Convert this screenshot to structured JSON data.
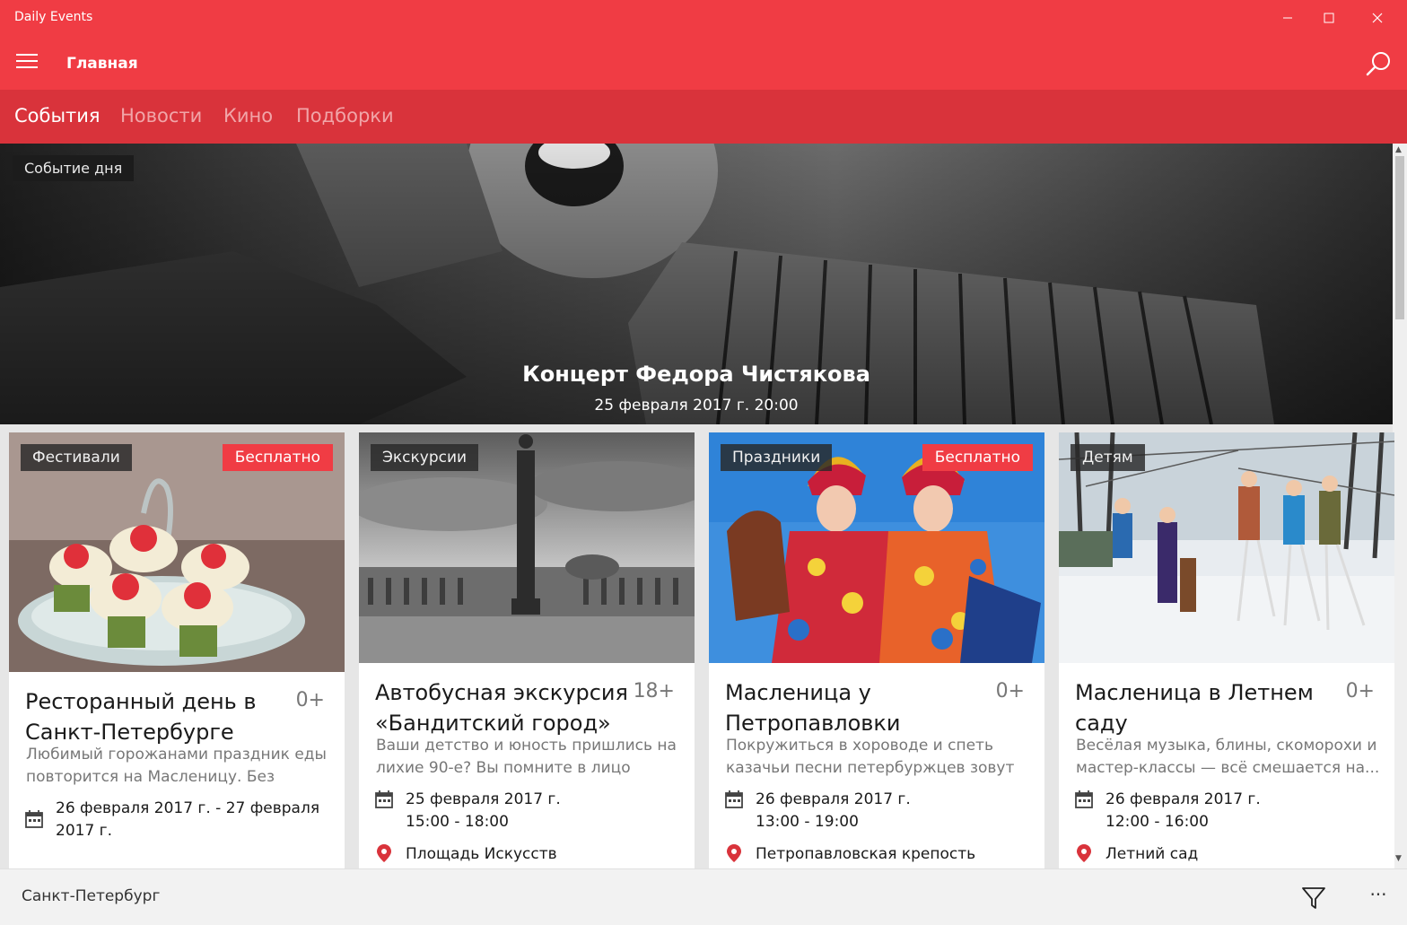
{
  "window": {
    "title": "Daily Events"
  },
  "appbar": {
    "page_title": "Главная"
  },
  "tabs": [
    {
      "label": "События",
      "active": true
    },
    {
      "label": "Новости",
      "active": false
    },
    {
      "label": "Кино",
      "active": false
    },
    {
      "label": "Подборки",
      "active": false
    }
  ],
  "hero": {
    "badge": "Событие дня",
    "title": "Концерт Федора Чистякова",
    "date": "25 февраля 2017 г.   20:00"
  },
  "cards": [
    {
      "category": "Фестивали",
      "free_label": "Бесплатно",
      "title": "Ресторанный день в Санкт-Петербурге",
      "age": "0+",
      "description": "Любимый горожанами праздник еды повторится на Масленицу. Без блин...",
      "date": "26 февраля 2017 г. - 27 февраля 2017 г.",
      "place": ""
    },
    {
      "category": "Экскурсии",
      "free_label": "",
      "title": "Автобусная экскурсия «Бандитский город»",
      "age": "18+",
      "description": "Ваши детство и юность пришлись на лихие 90-е? Вы помните в лицо всех...",
      "date": "25 февраля 2017 г.",
      "time": "15:00 - 18:00",
      "place": "Площадь Искусств"
    },
    {
      "category": "Праздники",
      "free_label": "Бесплатно",
      "title": "Масленица у Петропавловки",
      "age": "0+",
      "description": "Покружиться в хороводе и спеть казачьи песни петербуржцев зовут в...",
      "date": "26 февраля 2017 г.",
      "time": "13:00 - 19:00",
      "place": "Петропавловская крепость"
    },
    {
      "category": "Детям",
      "free_label": "",
      "title": "Масленица в Летнем саду",
      "age": "0+",
      "description": "Весёлая музыка, блины, скоморохи и мастер-классы — всё смешается на...",
      "date": "26 февраля 2017 г.",
      "time": "12:00 - 16:00",
      "place": "Летний сад"
    }
  ],
  "bottombar": {
    "city": "Санкт-Петербург",
    "more": "···"
  },
  "colors": {
    "accent": "#f03c44",
    "tabs_bg": "#d9333b",
    "pin": "#d9333b"
  }
}
